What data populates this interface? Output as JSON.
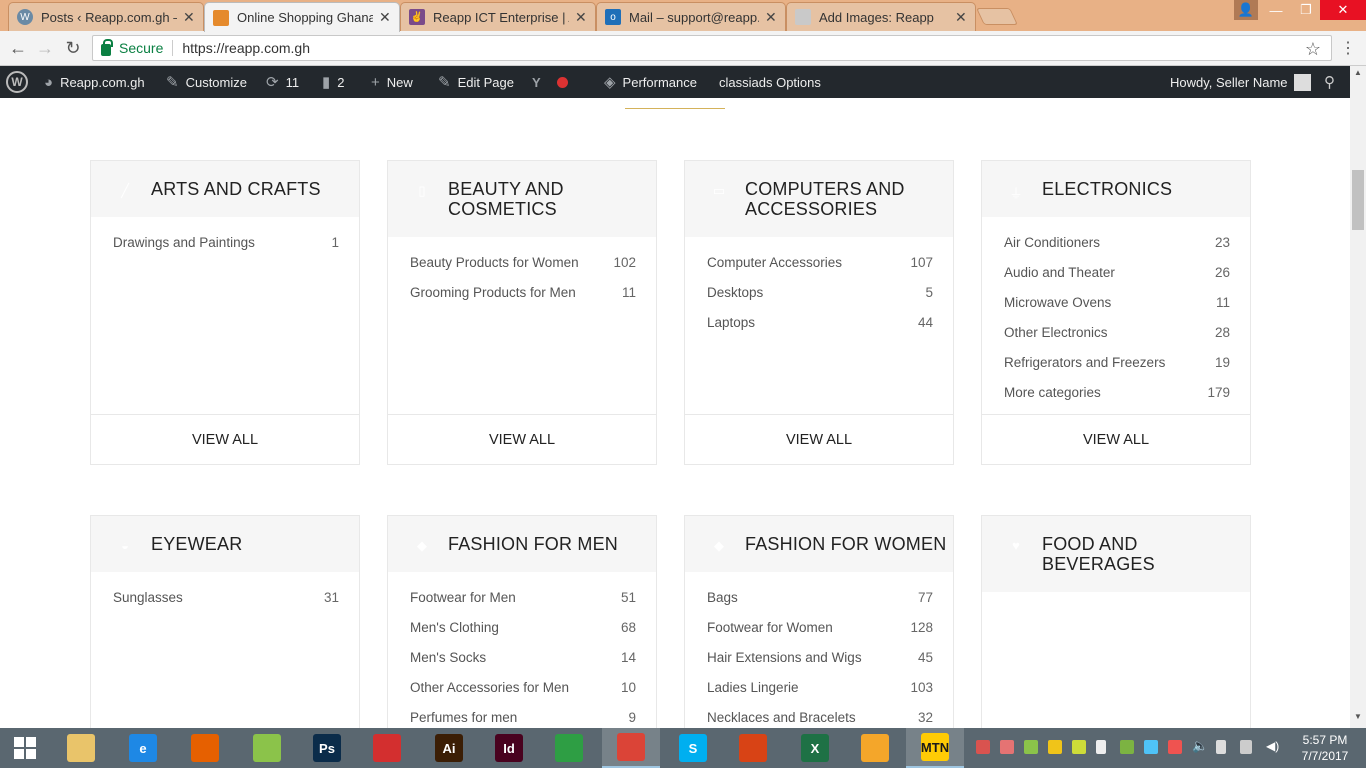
{
  "browser": {
    "tabs": [
      {
        "title": "Posts ‹ Reapp.com.gh —",
        "icon": "wordpress-icon",
        "color": "#6a8aa5"
      },
      {
        "title": "Online Shopping Ghana",
        "icon": "shop-icon",
        "color": "#e58a2c",
        "active": true
      },
      {
        "title": "Reapp ICT Enterprise | A",
        "icon": "reapp-logo-icon",
        "color": "#7a4b8a"
      },
      {
        "title": "Mail – support@reapp.co",
        "icon": "outlook-icon",
        "color": "#1f6fb8"
      },
      {
        "title": "Add Images: Reapp",
        "icon": "image-icon",
        "color": "#c9c9c9"
      }
    ],
    "secure_label": "Secure",
    "url": "https://reapp.com.gh"
  },
  "adminbar": {
    "site": "Reapp.com.gh",
    "customize": "Customize",
    "updates": "11",
    "comments": "2",
    "new": "New",
    "edit_page": "Edit Page",
    "performance": "Performance",
    "classiads": "classiads Options",
    "howdy": "Howdy, Seller Name"
  },
  "categories": [
    {
      "name": "ARTS AND CRAFTS",
      "icon": "brush-icon",
      "items": [
        {
          "label": "Drawings and Paintings",
          "count": "1"
        }
      ],
      "view_all": "VIEW ALL"
    },
    {
      "name": "BEAUTY AND COSMETICS",
      "icon": "lipstick-icon",
      "items": [
        {
          "label": "Beauty Products for Women",
          "count": "102"
        },
        {
          "label": "Grooming Products for Men",
          "count": "11"
        }
      ],
      "view_all": "VIEW ALL"
    },
    {
      "name": "COMPUTERS AND ACCESSORIES",
      "icon": "monitor-icon",
      "items": [
        {
          "label": "Computer Accessories",
          "count": "107"
        },
        {
          "label": "Desktops",
          "count": "5"
        },
        {
          "label": "Laptops",
          "count": "44"
        }
      ],
      "view_all": "VIEW ALL"
    },
    {
      "name": "ELECTRONICS",
      "icon": "plug-icon",
      "items": [
        {
          "label": "Air Conditioners",
          "count": "23"
        },
        {
          "label": "Audio and Theater",
          "count": "26"
        },
        {
          "label": "Microwave Ovens",
          "count": "11"
        },
        {
          "label": "Other Electronics",
          "count": "28"
        },
        {
          "label": "Refrigerators and Freezers",
          "count": "19"
        },
        {
          "label": "More categories",
          "count": "179"
        }
      ],
      "view_all": "VIEW ALL"
    },
    {
      "name": "EYEWEAR",
      "icon": "glasses-icon",
      "items": [
        {
          "label": "Sunglasses",
          "count": "31"
        }
      ]
    },
    {
      "name": "FASHION FOR MEN",
      "icon": "diamond-icon",
      "items": [
        {
          "label": "Footwear for Men",
          "count": "51"
        },
        {
          "label": "Men's Clothing",
          "count": "68"
        },
        {
          "label": "Men's Socks",
          "count": "14"
        },
        {
          "label": "Other Accessories for Men",
          "count": "10"
        },
        {
          "label": "Perfumes for men",
          "count": "9"
        }
      ]
    },
    {
      "name": "FASHION FOR WOMEN",
      "icon": "diamond-icon",
      "items": [
        {
          "label": "Bags",
          "count": "77"
        },
        {
          "label": "Footwear for Women",
          "count": "128"
        },
        {
          "label": "Hair Extensions and Wigs",
          "count": "45"
        },
        {
          "label": "Ladies Lingerie",
          "count": "103"
        },
        {
          "label": "Necklaces and Bracelets",
          "count": "32"
        }
      ]
    },
    {
      "name": "FOOD AND BEVERAGES",
      "icon": "heart-icon",
      "items": []
    }
  ],
  "taskbar": {
    "apps": [
      {
        "name": "file-explorer",
        "label": "",
        "color": "#e9c46a"
      },
      {
        "name": "internet-explorer",
        "label": "e",
        "color": "#1e88e5"
      },
      {
        "name": "firefox",
        "label": "",
        "color": "#e66000"
      },
      {
        "name": "paint",
        "label": "",
        "color": "#8bc34a"
      },
      {
        "name": "photoshop",
        "label": "Ps",
        "color": "#0b2c4a"
      },
      {
        "name": "acrobat",
        "label": "",
        "color": "#d32f2f"
      },
      {
        "name": "illustrator",
        "label": "Ai",
        "color": "#3b1e05"
      },
      {
        "name": "indesign",
        "label": "Id",
        "color": "#49021f"
      },
      {
        "name": "store",
        "label": "",
        "color": "#2e9e44"
      },
      {
        "name": "chrome",
        "label": "",
        "color": "#db4437",
        "active": true
      },
      {
        "name": "skype",
        "label": "S",
        "color": "#00aff0"
      },
      {
        "name": "office-lens",
        "label": "",
        "color": "#d84315"
      },
      {
        "name": "excel",
        "label": "X",
        "color": "#1e7145"
      },
      {
        "name": "media-player",
        "label": "",
        "color": "#f4a62a"
      },
      {
        "name": "mtn",
        "label": "MTN",
        "color": "#ffcb05",
        "active": true
      }
    ],
    "time": "5:57 PM",
    "date": "7/7/2017"
  }
}
